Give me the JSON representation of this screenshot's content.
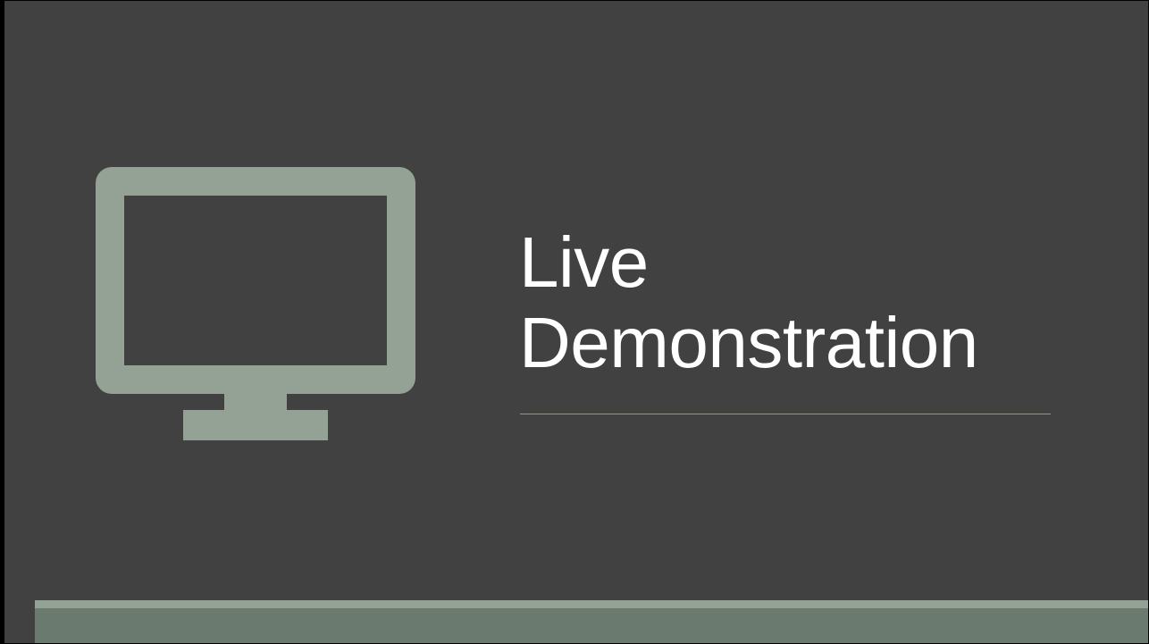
{
  "slide": {
    "title_line_1": "Live",
    "title_line_2": "Demonstration"
  },
  "icons": {
    "main_icon": "monitor-icon"
  },
  "colors": {
    "background": "#414141",
    "icon": "#93a294",
    "title_text": "#ffffff",
    "rule": "#8c9a86",
    "footer": "#6b7a6f",
    "footer_highlight": "#93a294"
  }
}
